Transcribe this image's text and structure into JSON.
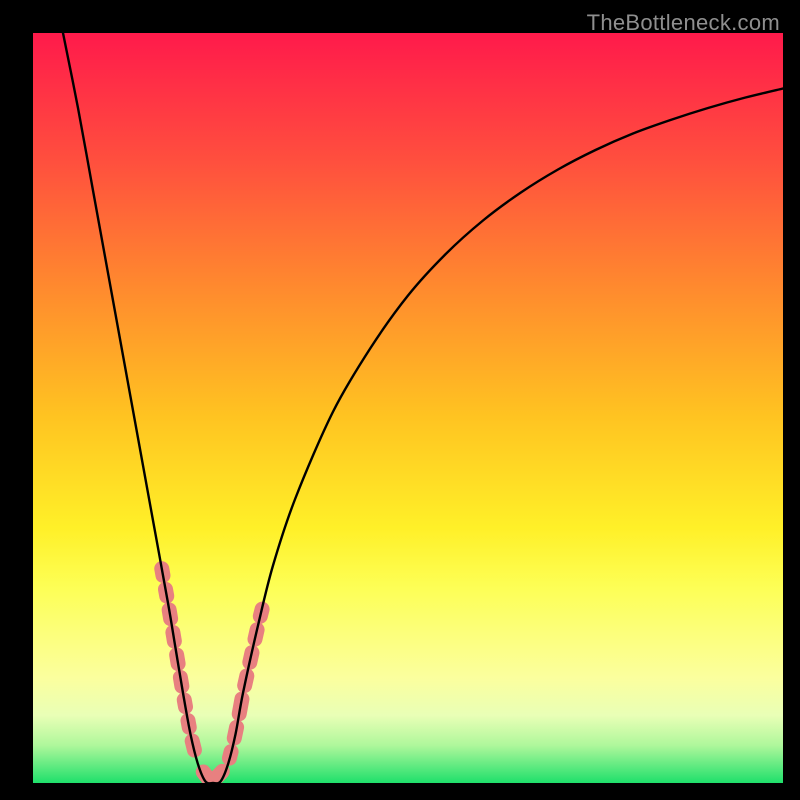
{
  "watermark": "TheBottleneck.com",
  "gradient_stops": [
    {
      "offset": 0,
      "color": "#ff1a4b"
    },
    {
      "offset": 0.17,
      "color": "#ff4f3e"
    },
    {
      "offset": 0.34,
      "color": "#ff8a2e"
    },
    {
      "offset": 0.51,
      "color": "#ffc321"
    },
    {
      "offset": 0.66,
      "color": "#fff028"
    },
    {
      "offset": 0.74,
      "color": "#fdff56"
    },
    {
      "offset": 0.8,
      "color": "#fcff7b"
    },
    {
      "offset": 0.86,
      "color": "#fbff9e"
    },
    {
      "offset": 0.91,
      "color": "#e9ffb6"
    },
    {
      "offset": 0.95,
      "color": "#aef79b"
    },
    {
      "offset": 1.0,
      "color": "#1fe06b"
    }
  ],
  "chart_data": {
    "type": "line",
    "title": "",
    "xlabel": "",
    "ylabel": "",
    "xlim": [
      0,
      100
    ],
    "ylim": [
      0,
      100
    ],
    "grid": false,
    "legend": false,
    "series": [
      {
        "name": "curve",
        "x": [
          4,
          6,
          8,
          10,
          12,
          14,
          16,
          18,
          19,
          20,
          21,
          22,
          23,
          24,
          25,
          26,
          27,
          28,
          30,
          32,
          35,
          40,
          45,
          50,
          55,
          60,
          65,
          70,
          75,
          80,
          85,
          90,
          95,
          100
        ],
        "values": [
          100,
          90,
          79,
          68,
          57,
          46,
          35,
          24,
          18,
          12,
          6.5,
          2.5,
          0.2,
          0,
          0.2,
          2.5,
          6.5,
          12,
          21,
          29,
          38,
          49.5,
          58,
          65,
          70.5,
          75,
          78.7,
          81.8,
          84.4,
          86.6,
          88.4,
          90,
          91.4,
          92.6
        ]
      }
    ],
    "highlight_zones": [
      {
        "name": "left-branch-markers",
        "x_range": [
          16.5,
          22.5
        ],
        "y_range": [
          2,
          30
        ]
      },
      {
        "name": "right-branch-markers",
        "x_range": [
          25.5,
          31.0
        ],
        "y_range": [
          2,
          27
        ]
      },
      {
        "name": "trough-markers",
        "x_range": [
          21.5,
          26.5
        ],
        "y_range": [
          0,
          2.5
        ]
      }
    ],
    "marker_color": "#e88080",
    "curve_color": "#000000"
  }
}
